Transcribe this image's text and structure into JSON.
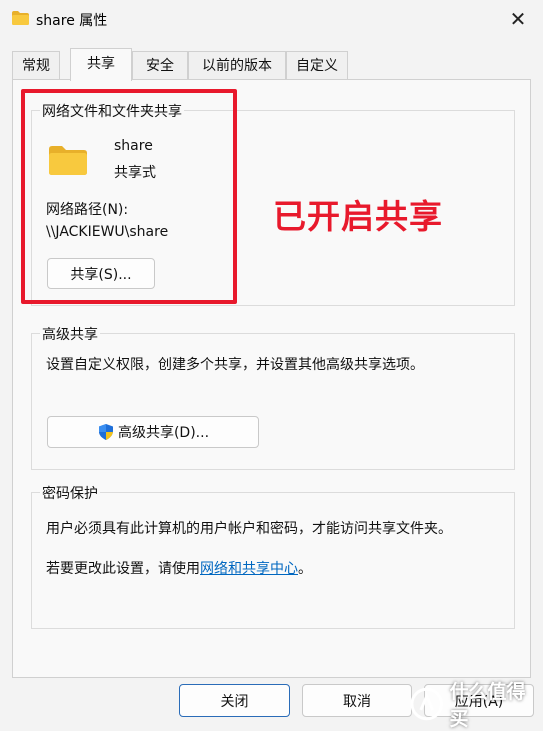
{
  "window": {
    "title": "share 属性"
  },
  "tabs": [
    {
      "label": "常规"
    },
    {
      "label": "共享"
    },
    {
      "label": "安全"
    },
    {
      "label": "以前的版本"
    },
    {
      "label": "自定义"
    }
  ],
  "network_share": {
    "group_title": "网络文件和文件夹共享",
    "folder_name": "share",
    "folder_status": "共享式",
    "path_label": "网络路径(N):",
    "path_value": "\\\\JACKIEWU\\share",
    "share_button": "共享(S)..."
  },
  "advanced_share": {
    "group_title": "高级共享",
    "description": "设置自定义权限，创建多个共享，并设置其他高级共享选项。",
    "button": "高级共享(D)..."
  },
  "password_protect": {
    "group_title": "密码保护",
    "description": "用户必须具有此计算机的用户帐户和密码，才能访问共享文件夹。",
    "change_prefix": "若要更改此设置，请使用",
    "change_link": "网络和共享中心",
    "change_suffix": "。"
  },
  "annotation": {
    "text": "已开启共享"
  },
  "footer": {
    "close": "关闭",
    "cancel": "取消",
    "apply": "应用(A)"
  },
  "watermark": {
    "text": "什么值得买"
  },
  "colors": {
    "annotation_red": "#e8192c",
    "link_blue": "#0067c0",
    "folder_yellow": "#f8c93e"
  }
}
